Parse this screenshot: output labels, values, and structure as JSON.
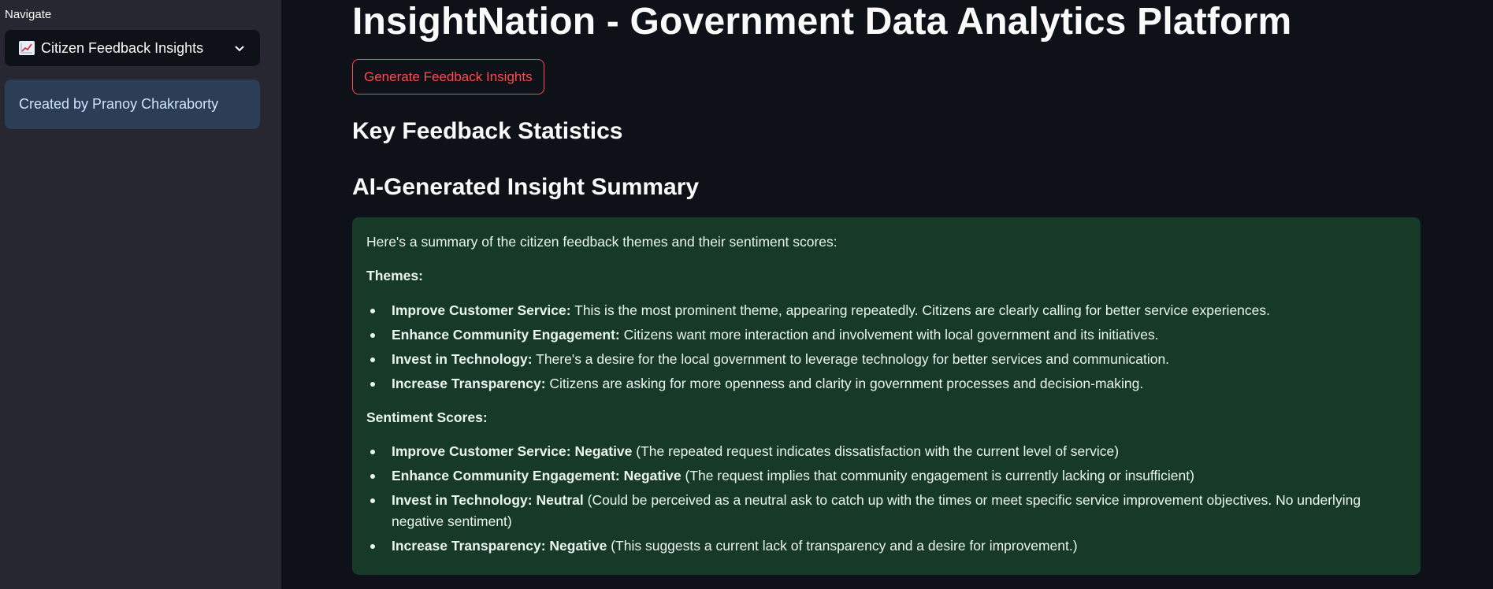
{
  "sidebar": {
    "navigate_label": "Navigate",
    "select_value": "Citizen Feedback Insights",
    "select_icon": "chart-increasing-icon",
    "credit": "Created by Pranoy Chakraborty"
  },
  "main": {
    "title": "InsightNation - Government Data Analytics Platform",
    "generate_button": "Generate Feedback Insights",
    "stats_heading": "Key Feedback Statistics",
    "summary_heading": "AI-Generated Insight Summary",
    "summary": {
      "intro": "Here's a summary of the citizen feedback themes and their sentiment scores:",
      "themes_heading": "Themes:",
      "themes": [
        {
          "label": "Improve Customer Service:",
          "text": " This is the most prominent theme, appearing repeatedly. Citizens are clearly calling for better service experiences."
        },
        {
          "label": "Enhance Community Engagement:",
          "text": " Citizens want more interaction and involvement with local government and its initiatives."
        },
        {
          "label": "Invest in Technology:",
          "text": " There's a desire for the local government to leverage technology for better services and communication."
        },
        {
          "label": "Increase Transparency:",
          "text": " Citizens are asking for more openness and clarity in government processes and decision-making."
        }
      ],
      "sentiment_heading": "Sentiment Scores:",
      "sentiments": [
        {
          "label": "Improve Customer Service: Negative",
          "text": " (The repeated request indicates dissatisfaction with the current level of service)"
        },
        {
          "label": "Enhance Community Engagement: Negative",
          "text": " (The request implies that community engagement is currently lacking or insufficient)"
        },
        {
          "label": "Invest in Technology: Neutral",
          "text": " (Could be perceived as a neutral ask to catch up with the times or meet specific service improvement objectives. No underlying negative sentiment)"
        },
        {
          "label": "Increase Transparency: Negative",
          "text": " (This suggests a current lack of transparency and a desire for improvement.)"
        }
      ]
    }
  },
  "colors": {
    "background": "#0e1117",
    "sidebar": "#262730",
    "accent": "#ff4b4b",
    "summary_box": "#173928",
    "credit_box": "#2b3e56"
  }
}
